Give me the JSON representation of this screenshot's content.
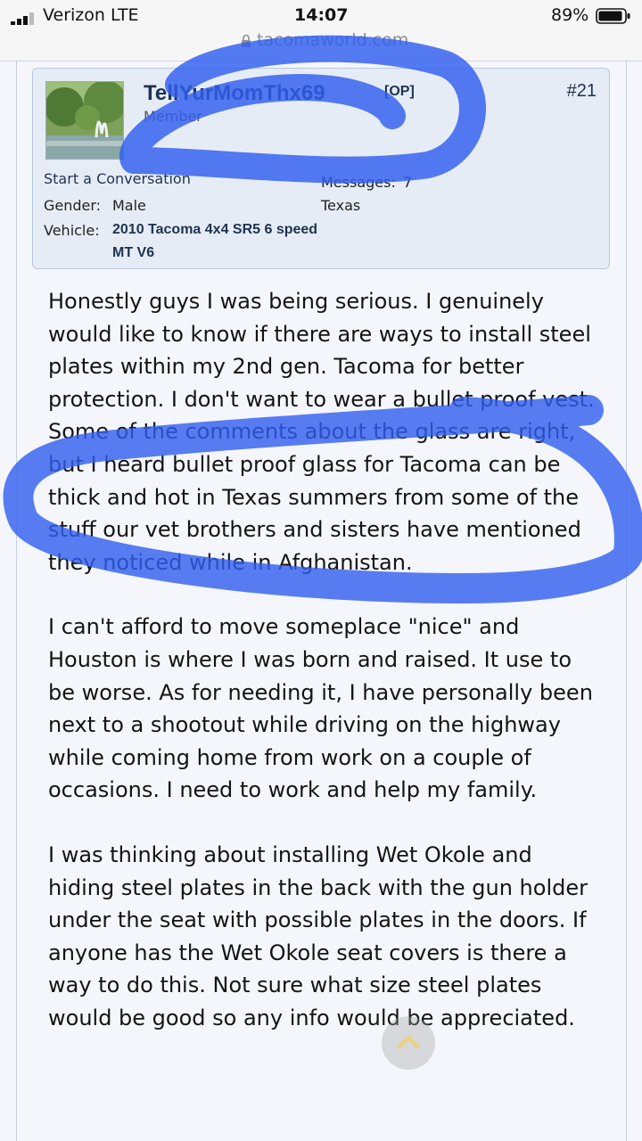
{
  "status_bar": {
    "carrier": "Verizon  LTE",
    "time": "14:07",
    "battery_percent": "89%",
    "url": "tacomaworld.com"
  },
  "post": {
    "username": "TellYurMomThx69",
    "op_badge": "[OP]",
    "post_number": "#21",
    "user_title": "Member",
    "start_conversation": "Start a Conversation",
    "gender_label": "Gender:",
    "gender_value": "Male",
    "vehicle_label": "Vehicle:",
    "vehicle_value": "2010 Tacoma 4x4 SR5 6 speed MT V6",
    "messages_label": "Messages:",
    "messages_value": "7",
    "location": "Texas",
    "paragraphs": [
      "Honestly guys I was being serious. I genuinely would like to know if there are ways to install steel plates within my 2nd gen. Tacoma for better protection. I don't want to wear a bullet proof vest. Some of the comments about the glass are right, but I heard bullet proof glass for Tacoma can be thick and hot in Texas summers from some of the stuff our vet brothers and sisters have mentioned they noticed while in Afghanistan.",
      "I can't afford to move someplace \"nice\" and Houston is where I was born and raised. It use to be worse. As for needing it, I have personally been next to a shootout while driving on the highway while coming home from work on a couple of occasions. I need to work and help my family.",
      "I was thinking about installing Wet Okole and hiding steel plates in the back with the gun holder under the seat with possible plates in the doors. If anyone has the Wet Okole seat covers is there a way to do this. Not sure what size steel plates would be good so any info would be appreciated."
    ]
  },
  "icons": [
    "signal-icon",
    "battery-icon",
    "lock-icon",
    "avatar-image",
    "scroll-top-icon"
  ],
  "colors": {
    "scribble": "#2f5ef0",
    "card_bg": "#e6ecf5",
    "username": "#1e3350"
  }
}
